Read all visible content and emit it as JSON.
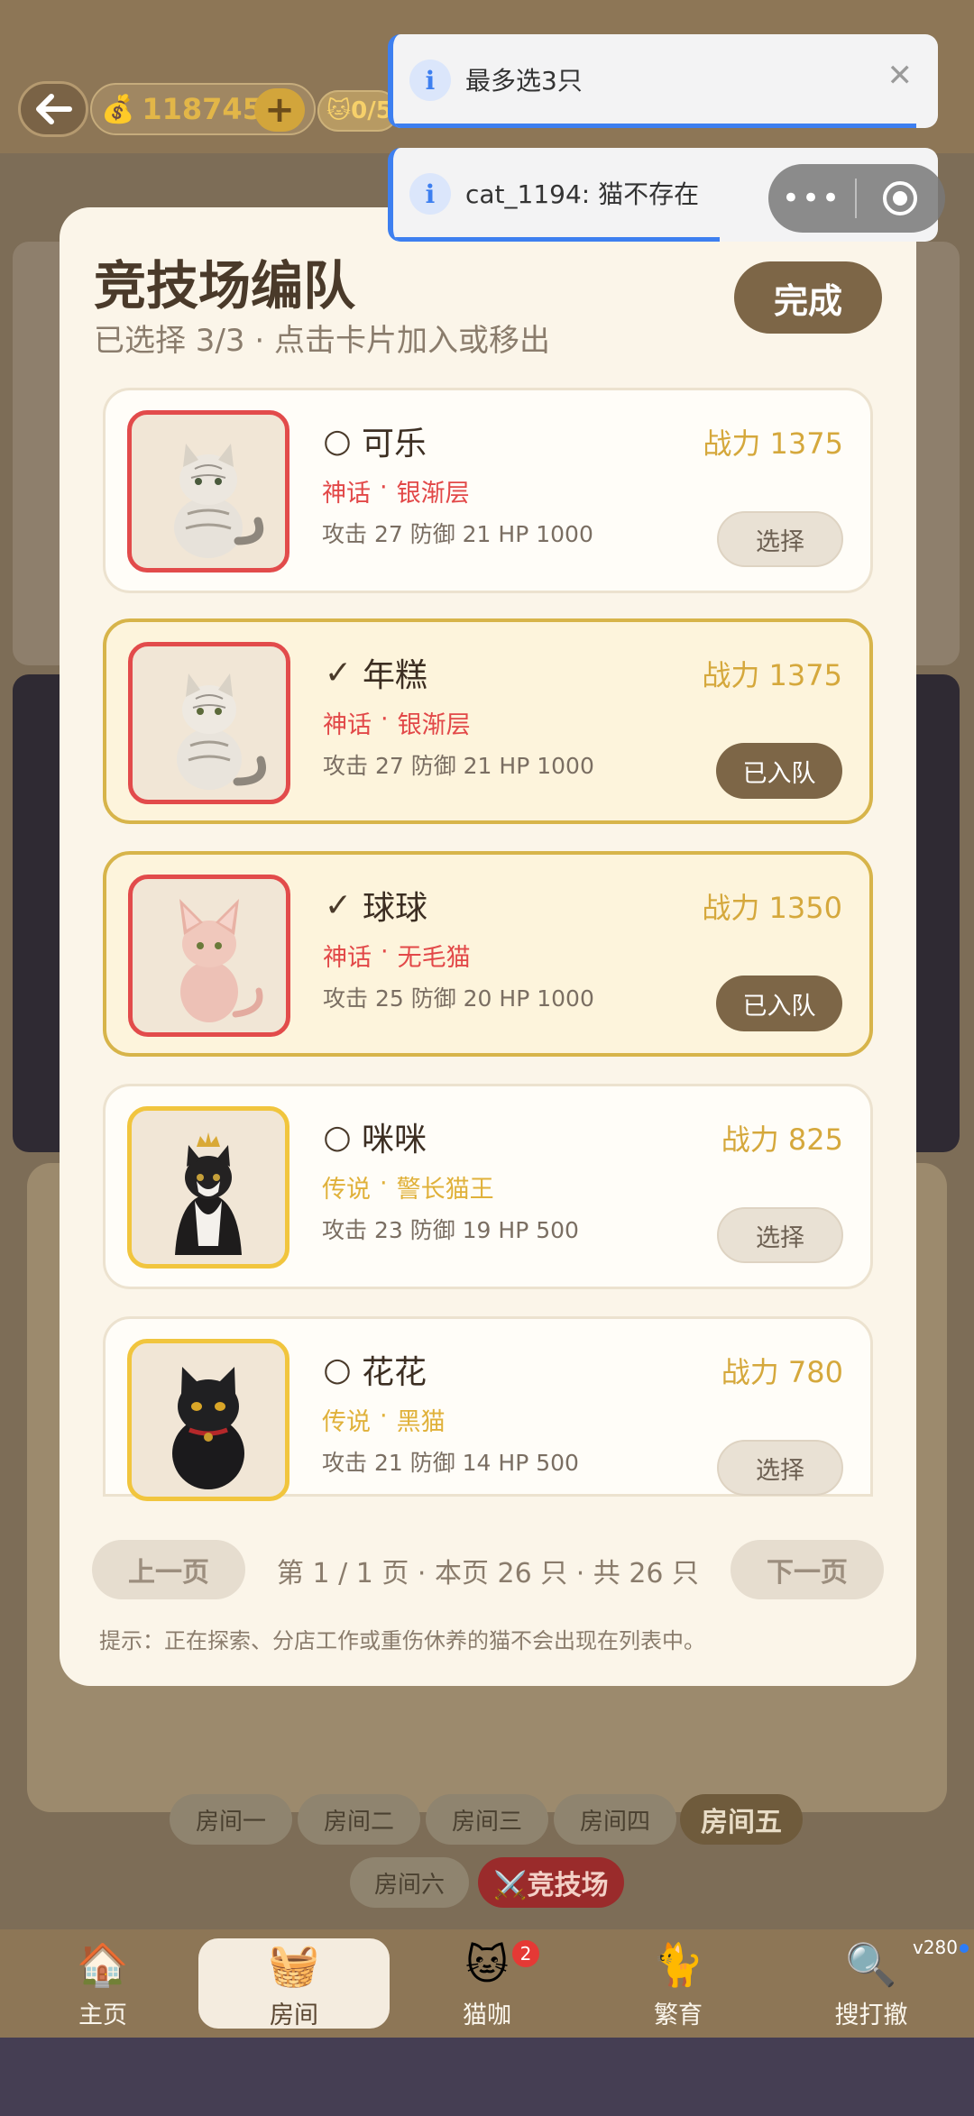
{
  "topbar": {
    "coins": "1187451",
    "plus_label": "+",
    "cat_count": "🐱0/5",
    "back_icon": "arrow-left-icon"
  },
  "toasts": [
    {
      "text": "最多选3只",
      "close": "✕",
      "progress": 0.96
    },
    {
      "text": "cat_1194: 猫不存在",
      "progress": 0.6
    }
  ],
  "modal": {
    "title": "竞技场编队",
    "subtitle": "已选择 3/3 · 点击卡片加入或移出",
    "done_label": "完成",
    "cats": [
      {
        "name": "可乐",
        "mark": "○",
        "power": "战力 1375",
        "rarity": "神话",
        "dot": "·",
        "breed": "银渐层",
        "stats": "攻击 27   防御 21   HP 1000",
        "button": "选择",
        "selected": false,
        "tier": "mythic"
      },
      {
        "name": "年糕",
        "mark": "✓",
        "power": "战力 1375",
        "rarity": "神话",
        "dot": "·",
        "breed": "银渐层",
        "stats": "攻击 27   防御 21   HP 1000",
        "button": "已入队",
        "selected": true,
        "tier": "mythic"
      },
      {
        "name": "球球",
        "mark": "✓",
        "power": "战力 1350",
        "rarity": "神话",
        "dot": "·",
        "breed": "无毛猫",
        "stats": "攻击 25   防御 20   HP 1000",
        "button": "已入队",
        "selected": true,
        "tier": "mythic"
      },
      {
        "name": "咪咪",
        "mark": "○",
        "power": "战力 825",
        "rarity": "传说",
        "dot": "·",
        "breed": "警长猫王",
        "stats": "攻击 23   防御 19   HP 500",
        "button": "选择",
        "selected": false,
        "tier": "legend"
      },
      {
        "name": "花花",
        "mark": "○",
        "power": "战力 780",
        "rarity": "传说",
        "dot": "·",
        "breed": "黑猫",
        "stats": "攻击 21   防御 14   HP 500",
        "button": "选择",
        "selected": false,
        "tier": "legend"
      }
    ],
    "pager": {
      "prev": "上一页",
      "info": "第 1 / 1 页 · 本页 26 只 · 共 26 只",
      "next": "下一页"
    },
    "hint": "提示：正在探索、分店工作或重伤休养的猫不会出现在列表中。"
  },
  "rooms": [
    "房间一",
    "房间二",
    "房间三",
    "房间四",
    "房间五",
    "房间六",
    "⚔️竞技场"
  ],
  "nav": [
    {
      "label": "主页",
      "icon": "home-icon",
      "glyph": "🏠"
    },
    {
      "label": "房间",
      "icon": "cat-bed-icon",
      "glyph": "🧺"
    },
    {
      "label": "猫咖",
      "icon": "cat-cafe-icon",
      "glyph": "🐱",
      "badge": "2"
    },
    {
      "label": "繁育",
      "icon": "breeding-icon",
      "glyph": "🐈"
    },
    {
      "label": "搜打撤",
      "icon": "search-icon",
      "glyph": "🔍"
    }
  ],
  "version": "v280",
  "colors": {
    "accent_brown": "#7d6647",
    "mythic_red": "#e24848",
    "legend_gold": "#e0b13a",
    "power_gold": "#d5a83c",
    "toast_blue": "#3d7ff0"
  }
}
